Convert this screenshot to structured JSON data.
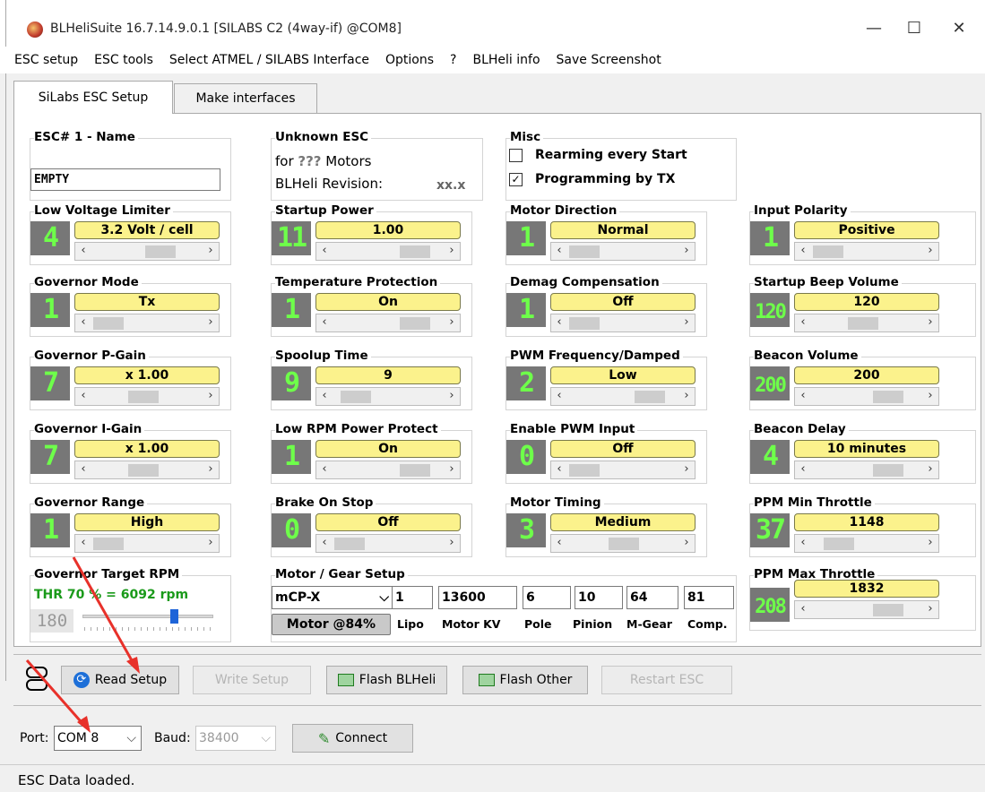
{
  "window": {
    "title": "BLHeliSuite 16.7.14.9.0.1  [SILABS C2 (4way-if) @COM8]",
    "min": "—",
    "max": "☐",
    "close": "✕"
  },
  "menu": [
    "ESC setup",
    "ESC tools",
    "Select ATMEL / SILABS Interface",
    "Options",
    "?",
    "BLHeli info",
    "Save Screenshot"
  ],
  "tabs": [
    "SiLabs ESC Setup",
    "Make interfaces"
  ],
  "esc_name": {
    "title": "ESC# 1 - Name",
    "value": "EMPTY"
  },
  "esc_info": {
    "title": "Unknown ESC",
    "line1a": "for ",
    "line1b": "???",
    "line1c": " Motors",
    "line2": "BLHeli Revision:",
    "rev": "xx.x"
  },
  "misc": {
    "title": "Misc",
    "rearm": "Rearming every Start",
    "rearm_checked": false,
    "prog": "Programming by TX",
    "prog_checked": true
  },
  "settings": [
    {
      "title": "Low Voltage Limiter",
      "num": "4",
      "value": "3.2 Volt / cell",
      "pos": 0.65
    },
    {
      "title": "Startup Power",
      "num": "11",
      "value": "1.00",
      "pos": 0.82
    },
    {
      "title": "Motor Direction",
      "num": "1",
      "value": "Normal",
      "pos": 0.02
    },
    {
      "title": "Input Polarity",
      "num": "1",
      "value": "Positive",
      "pos": 0.02
    },
    {
      "title": "Governor Mode",
      "num": "1",
      "value": "Tx",
      "pos": 0.02
    },
    {
      "title": "Temperature Protection",
      "num": "1",
      "value": "On",
      "pos": 0.82
    },
    {
      "title": "Demag Compensation",
      "num": "1",
      "value": "Off",
      "pos": 0.02
    },
    {
      "title": "Startup Beep Volume",
      "num": "120",
      "value": "120",
      "pos": 0.45
    },
    {
      "title": "Governor P-Gain",
      "num": "7",
      "value": "x 1.00",
      "pos": 0.45
    },
    {
      "title": "Spoolup Time",
      "num": "9",
      "value": "9",
      "pos": 0.1
    },
    {
      "title": "PWM Frequency/Damped",
      "num": "2",
      "value": "Low",
      "pos": 0.82
    },
    {
      "title": "Beacon Volume",
      "num": "200",
      "value": "200",
      "pos": 0.75
    },
    {
      "title": "Governor I-Gain",
      "num": "7",
      "value": "x 1.00",
      "pos": 0.45
    },
    {
      "title": "Low RPM Power Protect",
      "num": "1",
      "value": "On",
      "pos": 0.82
    },
    {
      "title": "Enable PWM Input",
      "num": "0",
      "value": "Off",
      "pos": 0.02
    },
    {
      "title": "Beacon Delay",
      "num": "4",
      "value": "10 minutes",
      "pos": 0.75
    },
    {
      "title": "Governor Range",
      "num": "1",
      "value": "High",
      "pos": 0.02
    },
    {
      "title": "Brake On Stop",
      "num": "0",
      "value": "Off",
      "pos": 0.02
    },
    {
      "title": "Motor Timing",
      "num": "3",
      "value": "Medium",
      "pos": 0.5
    },
    {
      "title": "PPM Min Throttle",
      "num": "37",
      "value": "1148",
      "pos": 0.15
    }
  ],
  "gov_rpm": {
    "title": "Governor Target RPM",
    "thr": "THR 70 % = 6092 rpm",
    "num": "180",
    "pos": 0.7
  },
  "gear": {
    "title": "Motor / Gear Setup",
    "model": "mCP-X",
    "fields": [
      "1",
      "13600",
      "6",
      "10",
      "64",
      "81"
    ],
    "labels": [
      "Motor @84%",
      "Lipo",
      "Motor KV",
      "Pole",
      "Pinion",
      "M-Gear",
      "Comp."
    ]
  },
  "ppm_max": {
    "title": "PPM Max Throttle",
    "num": "208",
    "value": "1832",
    "pos": 0.75
  },
  "buttons": {
    "read": "Read Setup",
    "write": "Write Setup",
    "flash": "Flash BLHeli",
    "flash_other": "Flash Other",
    "restart": "Restart ESC",
    "connect": "Connect"
  },
  "port": {
    "label": "Port:",
    "value": "COM 8",
    "baud_label": "Baud:",
    "baud": "38400"
  },
  "status": "ESC Data loaded."
}
